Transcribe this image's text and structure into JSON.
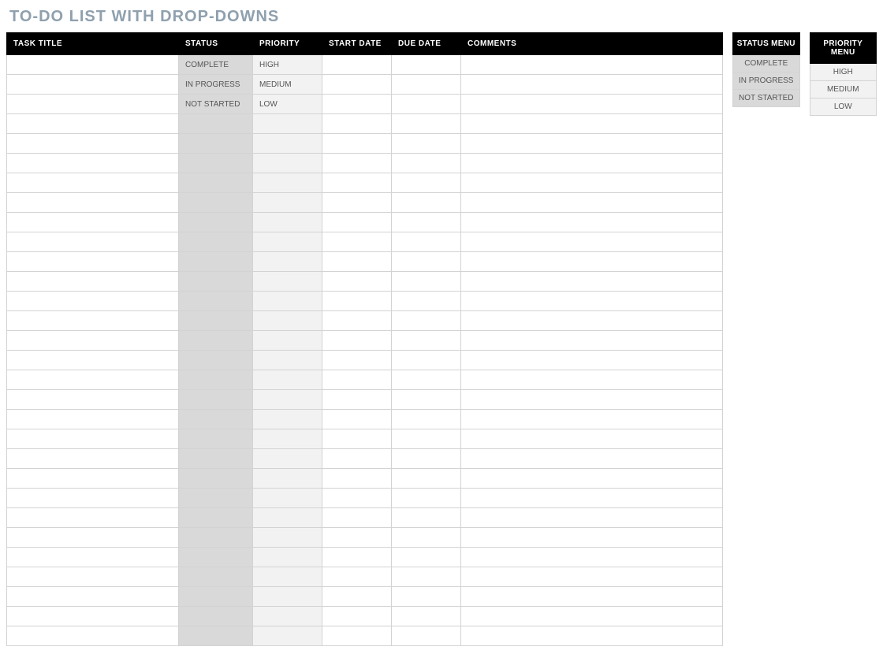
{
  "title": "TO-DO LIST WITH DROP-DOWNS",
  "columns": {
    "task_title": "TASK TITLE",
    "status": "STATUS",
    "priority": "PRIORITY",
    "start_date": "START DATE",
    "due_date": "DUE DATE",
    "comments": "COMMENTS"
  },
  "rows": [
    {
      "task_title": "",
      "status": "COMPLETE",
      "priority": "HIGH",
      "start_date": "",
      "due_date": "",
      "comments": ""
    },
    {
      "task_title": "",
      "status": "IN PROGRESS",
      "priority": "MEDIUM",
      "start_date": "",
      "due_date": "",
      "comments": ""
    },
    {
      "task_title": "",
      "status": "NOT STARTED",
      "priority": "LOW",
      "start_date": "",
      "due_date": "",
      "comments": ""
    },
    {
      "task_title": "",
      "status": "",
      "priority": "",
      "start_date": "",
      "due_date": "",
      "comments": ""
    },
    {
      "task_title": "",
      "status": "",
      "priority": "",
      "start_date": "",
      "due_date": "",
      "comments": ""
    },
    {
      "task_title": "",
      "status": "",
      "priority": "",
      "start_date": "",
      "due_date": "",
      "comments": ""
    },
    {
      "task_title": "",
      "status": "",
      "priority": "",
      "start_date": "",
      "due_date": "",
      "comments": ""
    },
    {
      "task_title": "",
      "status": "",
      "priority": "",
      "start_date": "",
      "due_date": "",
      "comments": ""
    },
    {
      "task_title": "",
      "status": "",
      "priority": "",
      "start_date": "",
      "due_date": "",
      "comments": ""
    },
    {
      "task_title": "",
      "status": "",
      "priority": "",
      "start_date": "",
      "due_date": "",
      "comments": ""
    },
    {
      "task_title": "",
      "status": "",
      "priority": "",
      "start_date": "",
      "due_date": "",
      "comments": ""
    },
    {
      "task_title": "",
      "status": "",
      "priority": "",
      "start_date": "",
      "due_date": "",
      "comments": ""
    },
    {
      "task_title": "",
      "status": "",
      "priority": "",
      "start_date": "",
      "due_date": "",
      "comments": ""
    },
    {
      "task_title": "",
      "status": "",
      "priority": "",
      "start_date": "",
      "due_date": "",
      "comments": ""
    },
    {
      "task_title": "",
      "status": "",
      "priority": "",
      "start_date": "",
      "due_date": "",
      "comments": ""
    },
    {
      "task_title": "",
      "status": "",
      "priority": "",
      "start_date": "",
      "due_date": "",
      "comments": ""
    },
    {
      "task_title": "",
      "status": "",
      "priority": "",
      "start_date": "",
      "due_date": "",
      "comments": ""
    },
    {
      "task_title": "",
      "status": "",
      "priority": "",
      "start_date": "",
      "due_date": "",
      "comments": ""
    },
    {
      "task_title": "",
      "status": "",
      "priority": "",
      "start_date": "",
      "due_date": "",
      "comments": ""
    },
    {
      "task_title": "",
      "status": "",
      "priority": "",
      "start_date": "",
      "due_date": "",
      "comments": ""
    },
    {
      "task_title": "",
      "status": "",
      "priority": "",
      "start_date": "",
      "due_date": "",
      "comments": ""
    },
    {
      "task_title": "",
      "status": "",
      "priority": "",
      "start_date": "",
      "due_date": "",
      "comments": ""
    },
    {
      "task_title": "",
      "status": "",
      "priority": "",
      "start_date": "",
      "due_date": "",
      "comments": ""
    },
    {
      "task_title": "",
      "status": "",
      "priority": "",
      "start_date": "",
      "due_date": "",
      "comments": ""
    },
    {
      "task_title": "",
      "status": "",
      "priority": "",
      "start_date": "",
      "due_date": "",
      "comments": ""
    },
    {
      "task_title": "",
      "status": "",
      "priority": "",
      "start_date": "",
      "due_date": "",
      "comments": ""
    },
    {
      "task_title": "",
      "status": "",
      "priority": "",
      "start_date": "",
      "due_date": "",
      "comments": ""
    },
    {
      "task_title": "",
      "status": "",
      "priority": "",
      "start_date": "",
      "due_date": "",
      "comments": ""
    },
    {
      "task_title": "",
      "status": "",
      "priority": "",
      "start_date": "",
      "due_date": "",
      "comments": ""
    },
    {
      "task_title": "",
      "status": "",
      "priority": "",
      "start_date": "",
      "due_date": "",
      "comments": ""
    }
  ],
  "status_menu": {
    "header": "STATUS MENU",
    "items": [
      "COMPLETE",
      "IN PROGRESS",
      "NOT STARTED"
    ]
  },
  "priority_menu": {
    "header": "PRIORITY MENU",
    "items": [
      "HIGH",
      "MEDIUM",
      "LOW"
    ]
  }
}
